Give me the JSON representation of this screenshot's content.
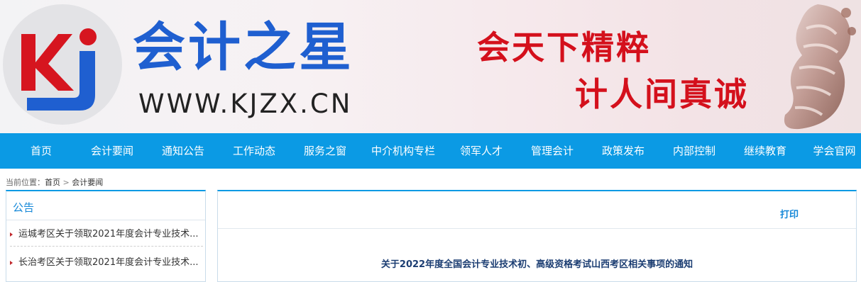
{
  "header": {
    "site_name": "会计之星",
    "site_url": "WWW.KJZX.CN",
    "slogan_line1": "会天下精粹",
    "slogan_line2": "计人间真诚",
    "logo_text": "kj",
    "colors": {
      "brand_blue": "#1f5fd0",
      "slogan_red": "#d4101c",
      "logo_red": "#d6151f"
    }
  },
  "nav": {
    "items": [
      {
        "label": "首页"
      },
      {
        "label": "会计要闻"
      },
      {
        "label": "通知公告"
      },
      {
        "label": "工作动态"
      },
      {
        "label": "服务之窗"
      },
      {
        "label": "中介机构专栏"
      },
      {
        "label": "领军人才"
      },
      {
        "label": "管理会计"
      },
      {
        "label": "政策发布"
      },
      {
        "label": "内部控制"
      },
      {
        "label": "继续教育"
      },
      {
        "label": "学会官网"
      }
    ],
    "color": "#0b9ae4"
  },
  "breadcrumb": {
    "prefix": "当前位置：",
    "home": "首页",
    "separator": ">",
    "current": "会计要闻"
  },
  "sidebar": {
    "title": "公告",
    "items": [
      {
        "label": "运城考区关于领取2021年度会计专业技术..."
      },
      {
        "label": "长治考区关于领取2021年度会计专业技术..."
      }
    ]
  },
  "article": {
    "print_label": "打印",
    "title": "关于2022年度全国会计专业技术初、高级资格考试山西考区相关事项的通知"
  }
}
